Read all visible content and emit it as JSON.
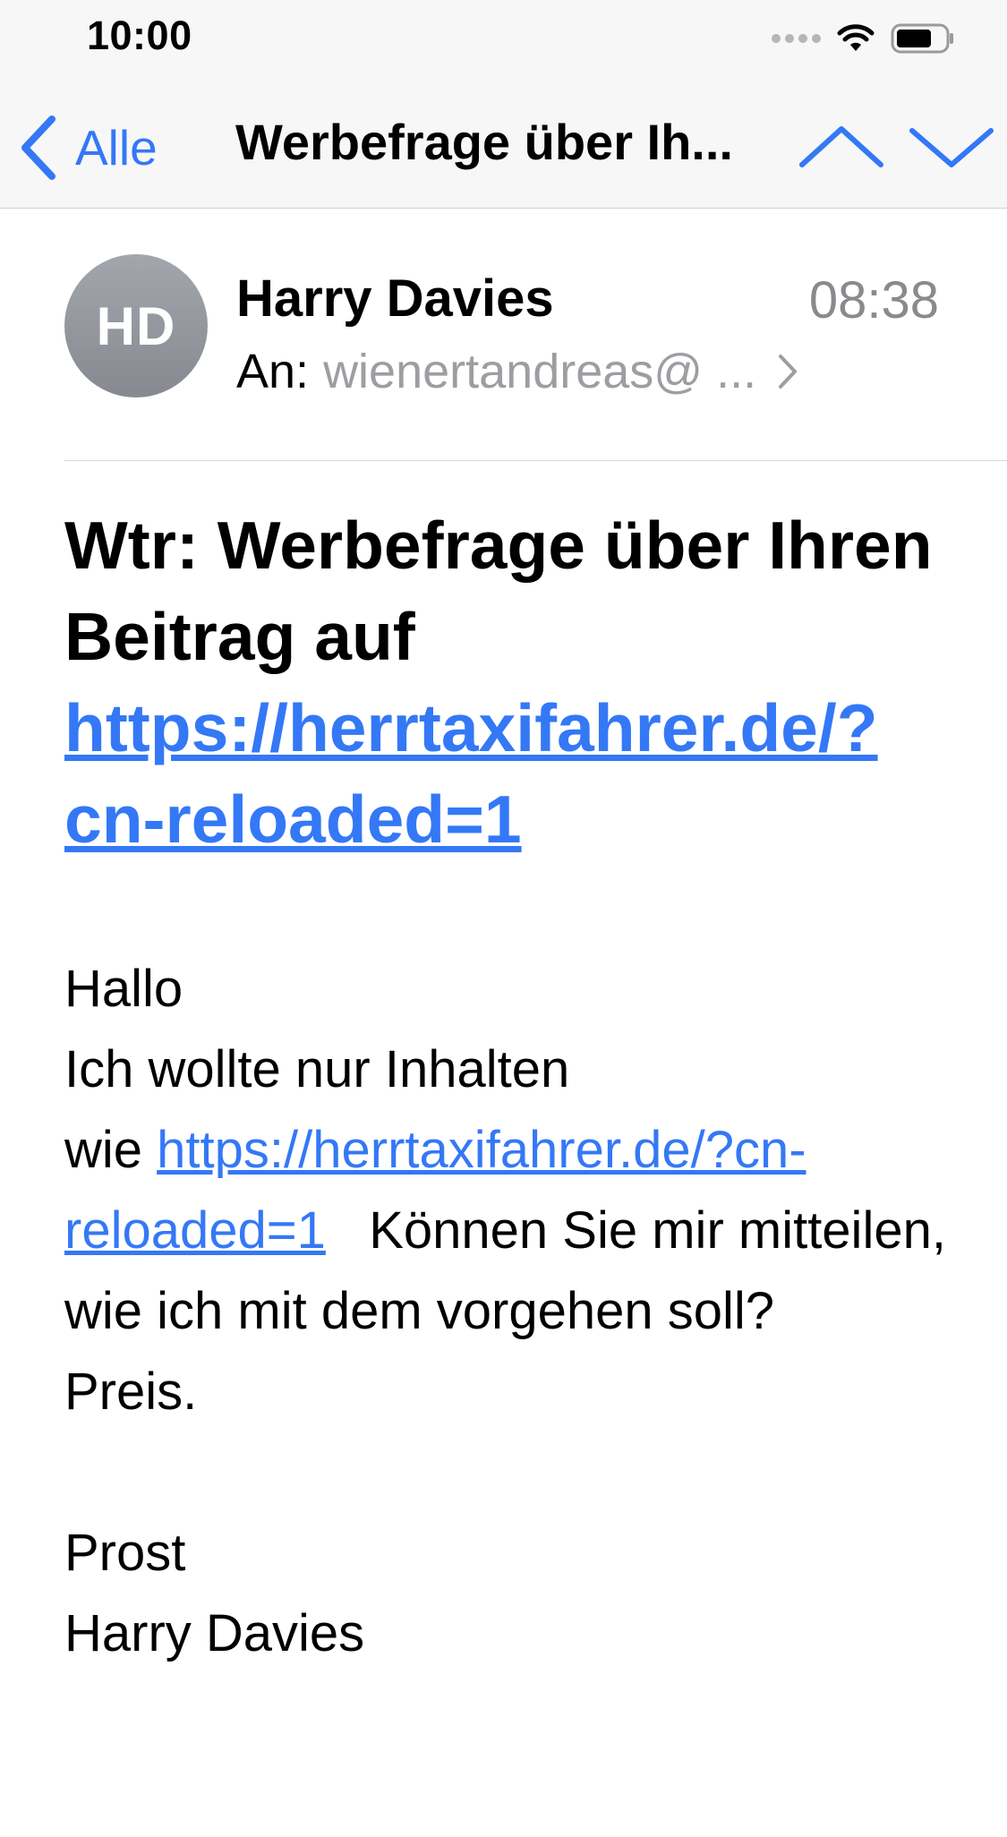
{
  "status_bar": {
    "time": "10:00"
  },
  "nav": {
    "back_label": "Alle",
    "title": "Werbefrage über Ih...",
    "icons": {
      "back": "chevron-left-icon",
      "previous": "chevron-up-icon",
      "next": "chevron-down-icon"
    }
  },
  "sender": {
    "initials": "HD",
    "name": "Harry Davies",
    "time": "08:38",
    "recipient_prefix": "An:",
    "recipient": "wienertandreas@ ..."
  },
  "subject": {
    "text": "Wtr: Werbefrage über Ihren Beitrag auf ",
    "link": "https://herrtaxifahrer.de/?cn-reloaded=1"
  },
  "body": {
    "greeting": "Hallo",
    "line1": "Ich wollte nur Inhalten",
    "line2_prefix": "wie ",
    "link": "https://herrtaxifahrer.de/?cn-reloaded=1",
    "line2_suffix": "   Können Sie mir mitteilen, wie ich mit dem vorgehen soll?",
    "line3": "Preis.",
    "closing": "Prost",
    "signature": "Harry Davies"
  },
  "colors": {
    "accent": "#3478f6",
    "secondary_text": "#8a8a8e",
    "avatar": "#9a9ca3",
    "bar_background": "#f7f7f7"
  }
}
